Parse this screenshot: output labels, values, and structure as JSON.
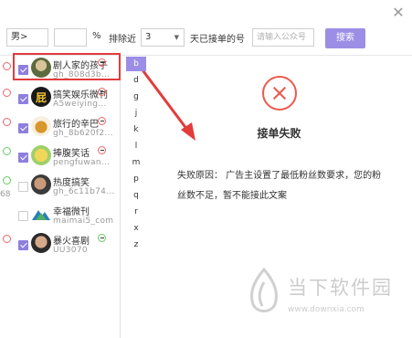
{
  "toolbar": {
    "gender_select": "男>",
    "percent_input": "",
    "percent_sign": "%",
    "exclude_label": "排除近",
    "days_select": "3",
    "days_suffix": "天已接单的号",
    "account_placeholder": "请输入公众号",
    "search_button": "搜索"
  },
  "accounts": [
    {
      "name": "剧人家的孩子",
      "id": "gh_808d3b...",
      "checked": true
    },
    {
      "name": "搞笑娱乐微刊",
      "id": "A5weiying...",
      "checked": true
    },
    {
      "name": "旅行的辛巴",
      "id": "gh_8b620f2...",
      "checked": true
    },
    {
      "name": "捧腹笑话",
      "id": "pengfuwan...",
      "checked": true
    },
    {
      "name": "热度搞笑",
      "id": "gh_6c11b74...",
      "checked": false
    },
    {
      "name": "幸福微刊",
      "id": "maimai5_com",
      "checked": false
    },
    {
      "name": "暴火喜剧",
      "id": "UU3070",
      "checked": true
    }
  ],
  "left_side_fragment": "68",
  "letters": [
    "b",
    "d",
    "g",
    "j",
    "k",
    "l",
    "m",
    "p",
    "q",
    "r",
    "x",
    "z"
  ],
  "active_letter": "b",
  "result": {
    "title": "接单失败",
    "reason": "失败原因： 广告主设置了最低粉丝数要求，您的粉丝数不足，暂不能接此文案"
  },
  "watermark": {
    "text": "当下软件园",
    "url": "www.downxia.com"
  },
  "colors": {
    "accent": "#9c8ee6",
    "fail": "#ea5a4c",
    "highlight": "#e23c3c"
  }
}
